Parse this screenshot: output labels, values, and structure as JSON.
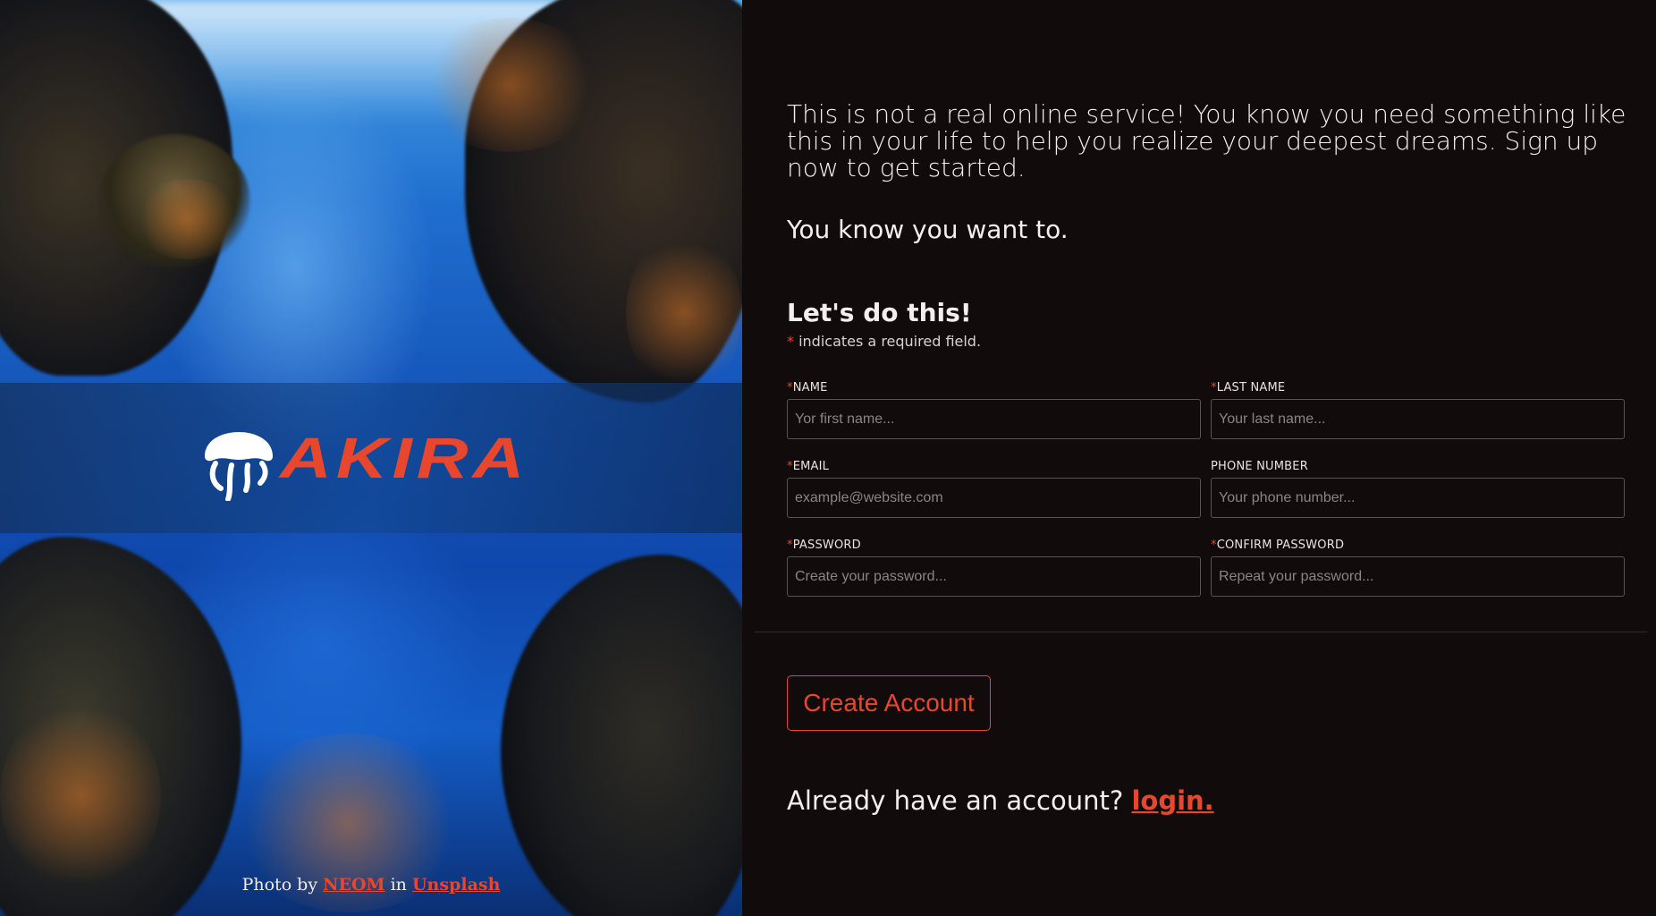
{
  "hero": {
    "logo_text": "AKIRA",
    "logo_icon": "jellyfish-icon",
    "credit_prefix": "Photo by",
    "credit_author": "NEOM",
    "credit_middle": "in",
    "credit_source": "Unsplash"
  },
  "intro": {
    "paragraph": "This is not a real online service! You know you need something like this in your life to help you realize your deepest dreams. Sign up now to get started.",
    "tagline": "You know you want to."
  },
  "form": {
    "title": "Let's do this!",
    "required_star": "*",
    "required_note": "indicates a required field.",
    "fields": {
      "name": {
        "star": "*",
        "label": "NAME",
        "placeholder": "Yor first name..."
      },
      "last_name": {
        "star": "*",
        "label": "LAST NAME",
        "placeholder": "Your last name..."
      },
      "email": {
        "star": "*",
        "label": "EMAIL",
        "placeholder": "example@website.com"
      },
      "phone": {
        "label": "PHONE NUMBER",
        "placeholder": "Your phone number..."
      },
      "password": {
        "star": "*",
        "label": "PASSWORD",
        "placeholder": "Create your password..."
      },
      "confirm_password": {
        "star": "*",
        "label": "CONFIRM PASSWORD",
        "placeholder": "Repeat your password..."
      }
    },
    "submit_label": "Create Account"
  },
  "login": {
    "prompt": "Already have an account?",
    "link": "login."
  },
  "colors": {
    "accent": "#e8472e",
    "background": "#110c0b"
  }
}
